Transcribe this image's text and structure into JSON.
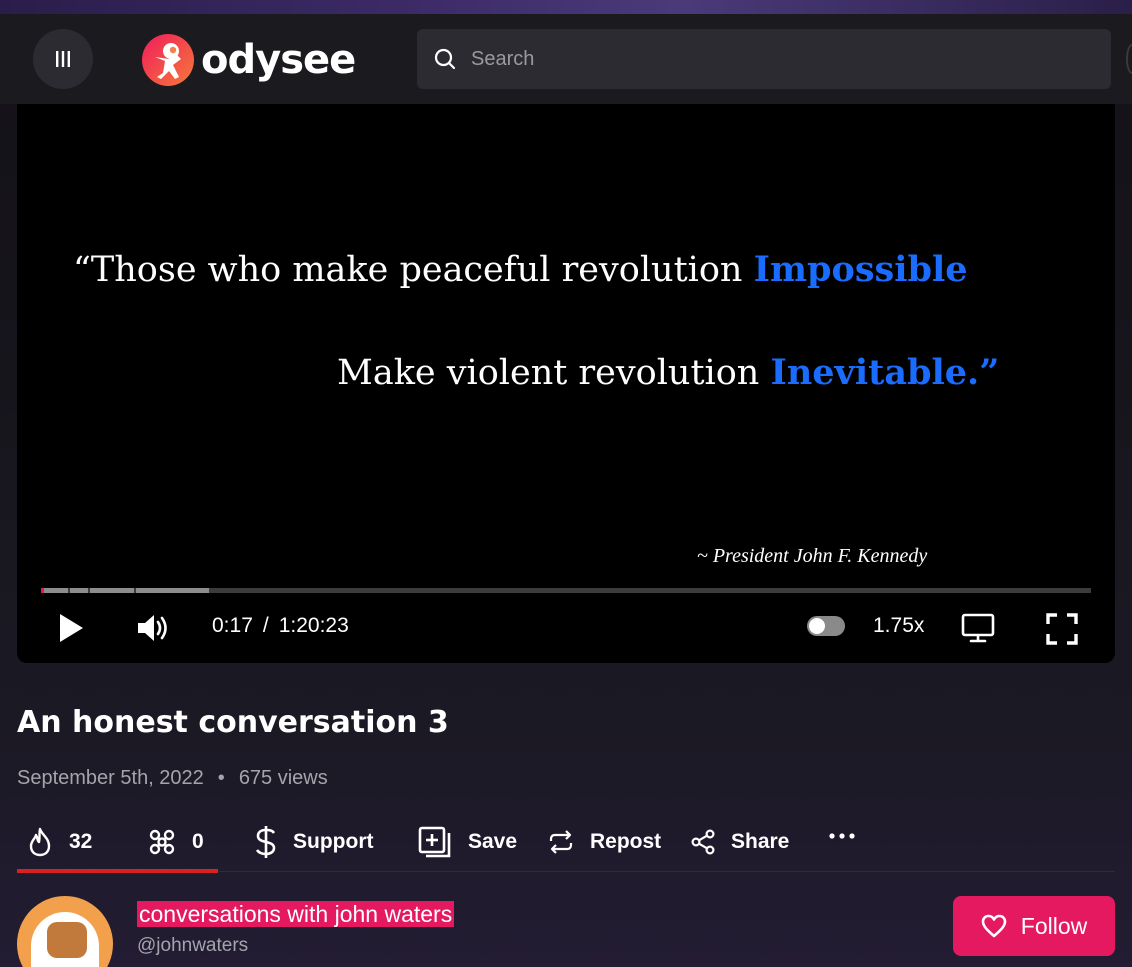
{
  "header": {
    "logo_text": "odysee",
    "search_placeholder": "Search"
  },
  "player": {
    "quote_line1": "“Those who make peaceful revolution ",
    "quote_line1_highlight": "Impossible",
    "quote_line2": "Make violent revolution ",
    "quote_line2_highlight": "Inevitable.”",
    "attribution": "~ President John F. Kennedy",
    "current_time": "0:17",
    "time_separator": "/",
    "duration": "1:20:23",
    "speed": "1.75x",
    "progress_played_fraction": 0.003,
    "progress_buffered_fraction": 0.16,
    "autoplay_on": false,
    "highlight_color": "#1a6cff"
  },
  "video": {
    "title": "An honest conversation 3",
    "date": "September 5th, 2022",
    "views": "675 views"
  },
  "actions": {
    "fire_count": "32",
    "slime_count": "0",
    "support_label": "Support",
    "save_label": "Save",
    "repost_label": "Repost",
    "share_label": "Share"
  },
  "channel": {
    "name": "conversations with john waters",
    "handle": "@johnwaters",
    "follow_label": "Follow",
    "accent_color": "#e4195f"
  }
}
